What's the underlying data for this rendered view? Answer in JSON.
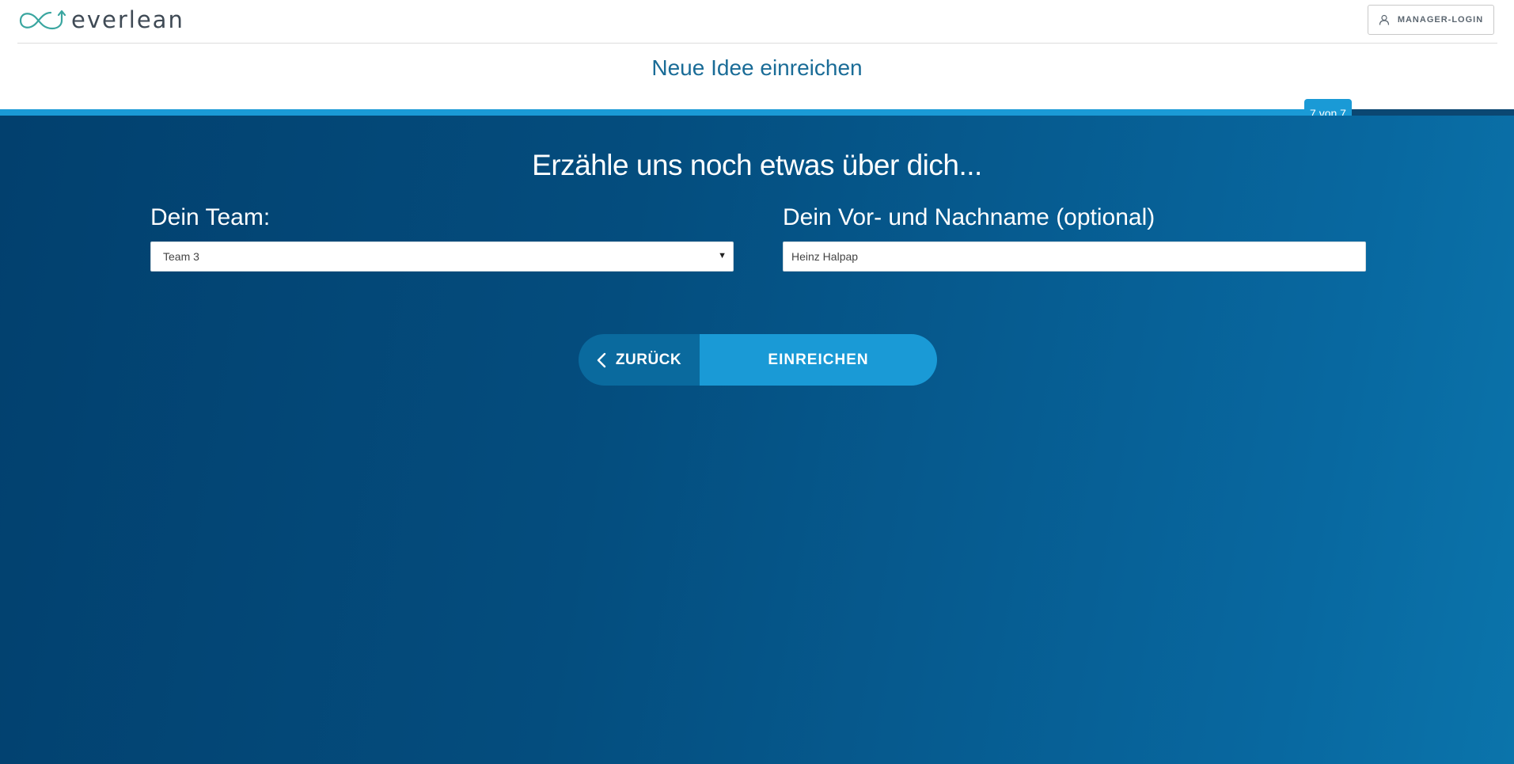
{
  "header": {
    "logo_text": "everlean",
    "manager_login_label": "MANAGER-LOGIN",
    "user_icon": "user-icon"
  },
  "page": {
    "title": "Neue Idee einreichen"
  },
  "progress": {
    "step_label": "7 von 7",
    "current_step": 7,
    "total_steps": 7,
    "fill_fraction": 0.88,
    "fill_color": "#1a9ad6",
    "track_color": "#0b4772"
  },
  "form": {
    "heading": "Erzähle uns noch etwas über dich...",
    "team_label": "Dein Team:",
    "team_selected": "Team 3",
    "name_label": "Dein Vor- und Nachname (optional)",
    "name_value": "Heinz Halpap"
  },
  "actions": {
    "back_label": "ZURÜCK",
    "submit_label": "EINREICHEN",
    "back_icon": "chevron-left-icon"
  },
  "colors": {
    "accent": "#1a9ad6",
    "title": "#1a6c97",
    "panel_dark": "#02406e",
    "panel_light": "#0b74ab"
  }
}
